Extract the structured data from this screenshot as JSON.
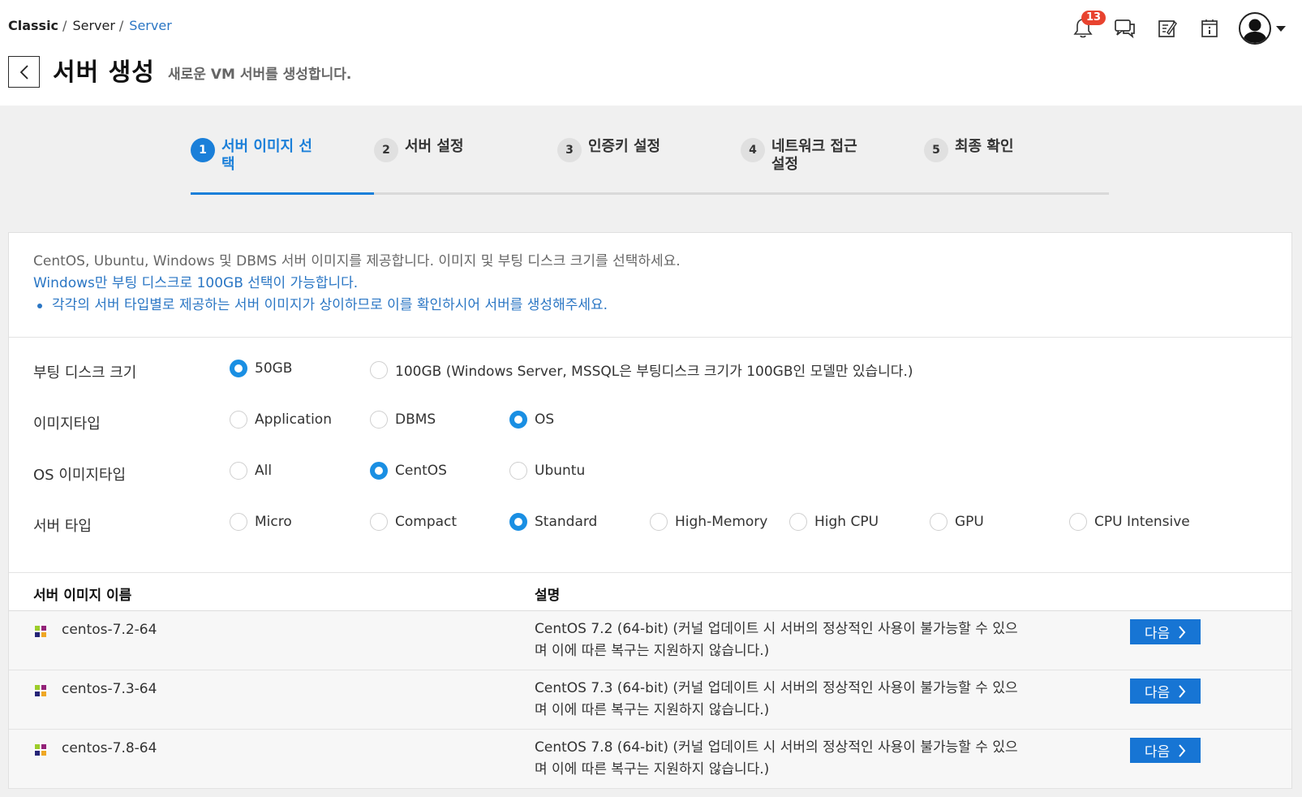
{
  "breadcrumb": {
    "items": [
      "Classic",
      "Server"
    ],
    "current": "Server"
  },
  "header": {
    "title": "서버 생성",
    "subtitle": "새로운 VM 서버를 생성합니다."
  },
  "notifications": {
    "count": "13"
  },
  "steps": [
    {
      "num": "1",
      "label": "서버 이미지 선택"
    },
    {
      "num": "2",
      "label": "서버 설정"
    },
    {
      "num": "3",
      "label": "인증키 설정"
    },
    {
      "num": "4",
      "label": "네트워크 접근 설정"
    },
    {
      "num": "5",
      "label": "최종 확인"
    }
  ],
  "info": {
    "line1": "CentOS, Ubuntu, Windows 및 DBMS 서버 이미지를 제공합니다. 이미지 및 부팅 디스크 크기를 선택하세요.",
    "line2": "Windows만 부팅 디스크로 100GB 선택이 가능합니다.",
    "line3": "각각의 서버 타입별로 제공하는 서버 이미지가 상이하므로 이를 확인하시어 서버를 생성해주세요."
  },
  "filters": {
    "boot_disk": {
      "label": "부팅 디스크 크기",
      "options": [
        "50GB",
        "100GB (Windows Server, MSSQL은 부팅디스크 크기가 100GB인 모델만 있습니다.)"
      ],
      "selected": "50GB"
    },
    "image_type": {
      "label": "이미지타입",
      "options": [
        "Application",
        "DBMS",
        "OS"
      ],
      "selected": "OS"
    },
    "os_image_type": {
      "label": "OS 이미지타입",
      "options": [
        "All",
        "CentOS",
        "Ubuntu"
      ],
      "selected": "CentOS"
    },
    "server_type": {
      "label": "서버 타입",
      "options": [
        "Micro",
        "Compact",
        "Standard",
        "High-Memory",
        "High CPU",
        "GPU",
        "CPU Intensive"
      ],
      "selected": "Standard"
    }
  },
  "table": {
    "headers": {
      "name": "서버 이미지 이름",
      "desc": "설명"
    },
    "rows": [
      {
        "name": "centos-7.2-64",
        "desc": "CentOS 7.2 (64-bit) (커널 업데이트 시 서버의 정상적인 사용이 불가능할 수 있으며 이에 따른 복구는 지원하지 않습니다.)",
        "action": "다음"
      },
      {
        "name": "centos-7.3-64",
        "desc": "CentOS 7.3 (64-bit) (커널 업데이트 시 서버의 정상적인 사용이 불가능할 수 있으며 이에 따른 복구는 지원하지 않습니다.)",
        "action": "다음"
      },
      {
        "name": "centos-7.8-64",
        "desc": "CentOS 7.8 (64-bit) (커널 업데이트 시 서버의 정상적인 사용이 불가능할 수 있으며 이에 따른 복구는 지원하지 않습니다.)",
        "action": "다음"
      }
    ]
  },
  "icons": {
    "notifications": "bell-icon",
    "chat": "chat-icon",
    "memo": "edit-note-icon",
    "info": "info-panel-icon",
    "avatar": "user-avatar-icon",
    "back": "chevron-left-icon",
    "centos": "centos-logo-icon"
  },
  "colors": {
    "accent": "#1a7fd9",
    "link": "#2a76c4",
    "button": "#1775d4",
    "badge": "#e8432f"
  }
}
